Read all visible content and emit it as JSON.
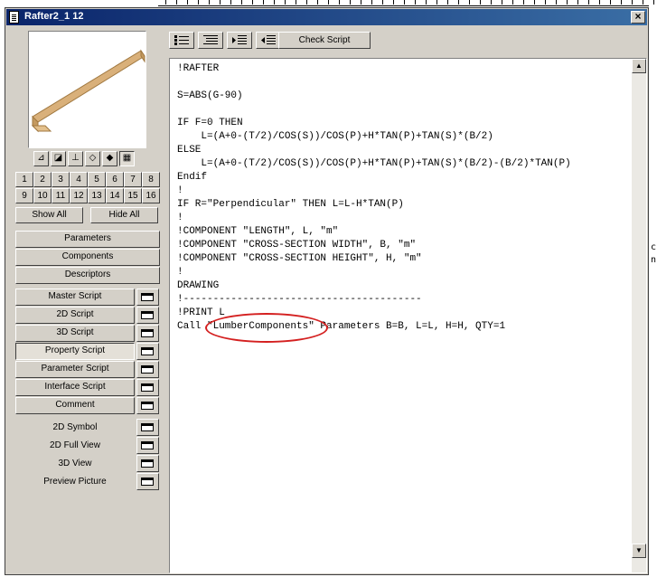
{
  "window": {
    "title": "Rafter2_1 12"
  },
  "view_buttons": [
    "plan-view-icon",
    "section-view-icon",
    "elevation-view-icon",
    "axon-view-icon",
    "perspective-view-icon",
    "filmstrip-view-icon"
  ],
  "numbers": [
    "1",
    "2",
    "3",
    "4",
    "5",
    "6",
    "7",
    "8",
    "9",
    "10",
    "11",
    "12",
    "13",
    "14",
    "15",
    "16"
  ],
  "show_all": "Show All",
  "hide_all": "Hide All",
  "groups": [
    "Parameters",
    "Components",
    "Descriptors"
  ],
  "scripts": [
    "Master Script",
    "2D Script",
    "3D Script",
    "Property Script",
    "Parameter Script",
    "Interface Script",
    "Comment"
  ],
  "active_script": "Property Script",
  "views": [
    "2D Symbol",
    "2D Full View",
    "3D View",
    "Preview Picture"
  ],
  "toolbar": {
    "check_script": "Check Script"
  },
  "code_lines": [
    "!RAFTER",
    "",
    "S=ABS(G-90)",
    "",
    "IF F=0 THEN",
    "    L=(A+0-(T/2)/COS(S))/COS(P)+H*TAN(P)+TAN(S)*(B/2)",
    "ELSE",
    "    L=(A+0-(T/2)/COS(S))/COS(P)+H*TAN(P)+TAN(S)*(B/2)-(B/2)*TAN(P)",
    "Endif",
    "!",
    "IF R=\"Perpendicular\" THEN L=L-H*TAN(P)",
    "!",
    "!COMPONENT \"LENGTH\", L, \"m\"",
    "!COMPONENT \"CROSS-SECTION WIDTH\", B, \"m\"",
    "!COMPONENT \"CROSS-SECTION HEIGHT\", H, \"m\"",
    "!",
    "DRAWING",
    "!----------------------------------------",
    "!PRINT L",
    "Call \"LumberComponents\" Parameters B=B, L=L, H=H, QTY=1"
  ],
  "bg_right_glyphs": [
    "c",
    "n"
  ],
  "colors": {
    "title_bar": "#0a246a",
    "highlight_oval": "#d42020",
    "wood": "#d9b07a"
  }
}
